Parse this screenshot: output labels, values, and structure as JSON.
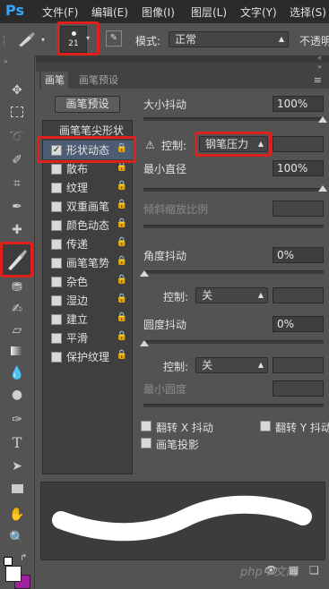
{
  "app": {
    "logo": "Ps"
  },
  "menubar": {
    "items": [
      "文件(F)",
      "编辑(E)",
      "图像(I)",
      "图层(L)",
      "文字(Y)",
      "选择(S)"
    ]
  },
  "options": {
    "brush_size": "21",
    "mode_label": "模式:",
    "mode_value": "正常",
    "opacity_label": "不透明"
  },
  "panel": {
    "tabs": [
      "画笔",
      "画笔预设"
    ],
    "preset_button": "画笔预设",
    "tip_shape_label": "画笔笔尖形状",
    "list": [
      {
        "label": "形状动态",
        "checked": true,
        "selected": true
      },
      {
        "label": "散布",
        "checked": false
      },
      {
        "label": "纹理",
        "checked": false
      },
      {
        "label": "双重画笔",
        "checked": false
      },
      {
        "label": "颜色动态",
        "checked": false
      },
      {
        "label": "传递",
        "checked": false
      },
      {
        "label": "画笔笔势",
        "checked": false
      },
      {
        "label": "杂色",
        "checked": false
      },
      {
        "label": "湿边",
        "checked": false
      },
      {
        "label": "建立",
        "checked": false
      },
      {
        "label": "平滑",
        "checked": false
      },
      {
        "label": "保护纹理",
        "checked": false
      }
    ],
    "size_jitter_label": "大小抖动",
    "size_jitter_value": "100%",
    "control_label": "控制:",
    "control_value": "钢笔压力",
    "min_diameter_label": "最小直径",
    "min_diameter_value": "100%",
    "tilt_scale_label": "倾斜缩放比例",
    "angle_jitter_label": "角度抖动",
    "angle_jitter_value": "0%",
    "angle_control_value": "关",
    "roundness_jitter_label": "圆度抖动",
    "roundness_jitter_value": "0%",
    "roundness_control_value": "关",
    "min_roundness_label": "最小圆度",
    "flip_x_label": "翻转 X 抖动",
    "flip_y_label": "翻转 Y 抖动",
    "brush_projection_label": "画笔投影"
  },
  "watermark": "php中文网"
}
